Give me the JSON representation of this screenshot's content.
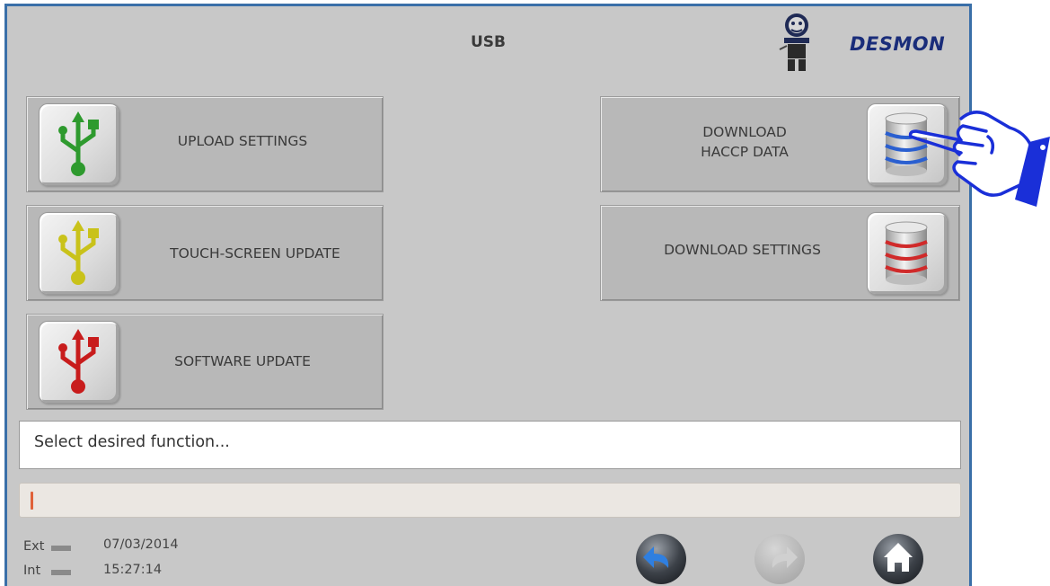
{
  "header": {
    "title": "USB",
    "brand": "DESMON"
  },
  "buttons": {
    "upload_settings": "UPLOAD SETTINGS",
    "touch_screen_update": "TOUCH-SCREEN UPDATE",
    "software_update": "SOFTWARE UPDATE",
    "download_haccp_line1": "DOWNLOAD",
    "download_haccp_line2": "HACCP DATA",
    "download_settings": "DOWNLOAD SETTINGS"
  },
  "status": {
    "message": "Select desired function...",
    "progress_percent": 0
  },
  "footer": {
    "ext_label": "Ext",
    "int_label": "Int",
    "date": "07/03/2014",
    "time": "15:27:14"
  },
  "icons": {
    "upload_settings": "usb-green-icon",
    "touch_screen_update": "usb-yellow-icon",
    "software_update": "usb-red-icon",
    "download_haccp": "database-blue-icon",
    "download_settings": "database-red-icon",
    "back": "back-arrow-icon",
    "forward": "forward-arrow-icon",
    "home": "home-icon"
  },
  "colors": {
    "frame": "#3a6fa8",
    "panel": "#c8c8c8",
    "usb_green": "#2e9a2e",
    "usb_yellow": "#c9c21a",
    "usb_red": "#c81c1c",
    "progress": "#e0623a",
    "brand": "#1a2d7a"
  }
}
